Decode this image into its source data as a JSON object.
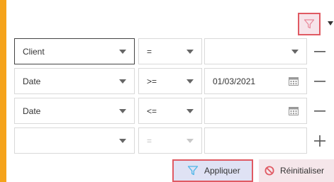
{
  "toolbar": {
    "filter_toggle_icon": "filter-icon",
    "menu_icon": "caret-down-icon"
  },
  "rows": [
    {
      "field": "Client",
      "operator": "=",
      "value": "",
      "value_type": "select",
      "action": "remove"
    },
    {
      "field": "Date",
      "operator": ">=",
      "value": "01/03/2021",
      "value_type": "date",
      "action": "remove"
    },
    {
      "field": "Date",
      "operator": "<=",
      "value": "",
      "value_type": "date",
      "action": "remove"
    },
    {
      "field": "",
      "operator": "=",
      "value": "",
      "value_type": "text",
      "action": "add"
    }
  ],
  "footer": {
    "apply_label": "Appliquer",
    "reset_label": "Réinitialiser"
  },
  "colors": {
    "accent_orange": "#f5a31a",
    "highlight_border": "#e05a63",
    "filter_icon": "#4db6e8",
    "reset_icon": "#e05a63"
  }
}
